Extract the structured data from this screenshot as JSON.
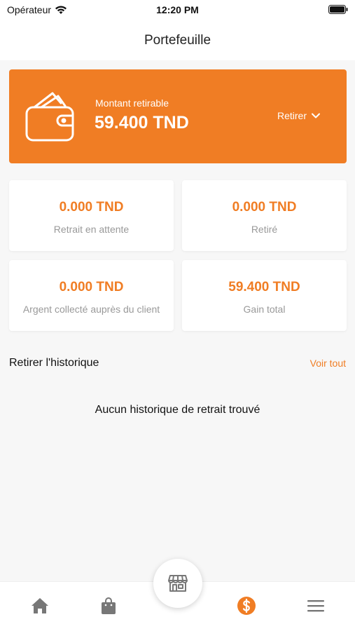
{
  "status_bar": {
    "carrier": "Opérateur",
    "time": "12:20 PM"
  },
  "nav": {
    "title": "Portefeuille"
  },
  "balance": {
    "label": "Montant retirable",
    "amount": "59.400 TND",
    "withdraw_label": "Retirer"
  },
  "stats": [
    {
      "value": "0.000 TND",
      "label": "Retrait en attente"
    },
    {
      "value": "0.000 TND",
      "label": "Retiré"
    },
    {
      "value": "0.000 TND",
      "label": "Argent collecté auprès du client"
    },
    {
      "value": "59.400 TND",
      "label": "Gain total"
    }
  ],
  "history": {
    "title": "Retirer l'historique",
    "see_all": "Voir tout",
    "empty_message": "Aucun historique de retrait trouvé"
  },
  "tab_bar": {
    "items": [
      {
        "icon": "home-icon",
        "active": false
      },
      {
        "icon": "shopping-bag-icon",
        "active": false
      },
      {
        "icon": "store-icon",
        "active": false
      },
      {
        "icon": "dollar-icon",
        "active": true
      },
      {
        "icon": "menu-icon",
        "active": false
      }
    ]
  },
  "colors": {
    "accent": "#f07d24",
    "inactive_icon": "#777777",
    "background": "#f7f7f7"
  }
}
